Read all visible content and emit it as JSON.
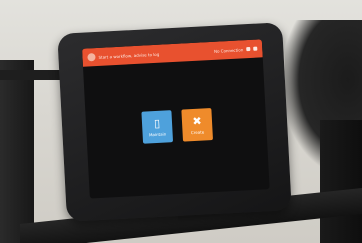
{
  "status_bar": {
    "welcome_text": "Start a workflow, advise to log",
    "right_text": "No Connection",
    "icons": [
      "wifi-icon",
      "battery-icon"
    ]
  },
  "tiles": [
    {
      "label": "Maintain",
      "icon": "bucket-icon",
      "color": "#4ea1dc"
    },
    {
      "label": "Create",
      "icon": "tools-icon",
      "color": "#ef8b2b"
    }
  ],
  "colors": {
    "status_bar": "#e8512f",
    "screen_bg": "#0f0f10"
  }
}
